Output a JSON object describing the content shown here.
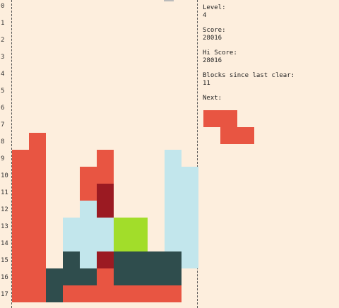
{
  "row_numbers": [
    "0",
    "1",
    "2",
    "3",
    "4",
    "5",
    "6",
    "7",
    "8",
    "9",
    "10",
    "11",
    "12",
    "13",
    "14",
    "15",
    "16",
    "17"
  ],
  "colors": {
    "red": "#e85542",
    "darkred": "#9b1a22",
    "lightblue": "#c2e6ec",
    "green": "#a2dd2a",
    "darkslate": "#2f4d4d",
    "background": "#fdeedd"
  },
  "info": {
    "level_label": "Level:",
    "level_value": "4",
    "score_label": "Score:",
    "score_value": "28016",
    "hiscore_label": "Hi Score:",
    "hiscore_value": "28016",
    "blocks_label": "Blocks since last clear:",
    "blocks_value": "11",
    "next_label": "Next:"
  },
  "board": {
    "columns": 11,
    "cells": [
      {
        "row": 8,
        "col": 1,
        "color": "red"
      },
      {
        "row": 9,
        "col": 0,
        "color": "red"
      },
      {
        "row": 9,
        "col": 1,
        "color": "red"
      },
      {
        "row": 9,
        "col": 5,
        "color": "red"
      },
      {
        "row": 9,
        "col": 9,
        "color": "lightblue"
      },
      {
        "row": 10,
        "col": 0,
        "color": "red"
      },
      {
        "row": 10,
        "col": 1,
        "color": "red"
      },
      {
        "row": 10,
        "col": 4,
        "color": "red"
      },
      {
        "row": 10,
        "col": 5,
        "color": "red"
      },
      {
        "row": 10,
        "col": 9,
        "color": "lightblue"
      },
      {
        "row": 10,
        "col": 10,
        "color": "lightblue"
      },
      {
        "row": 11,
        "col": 0,
        "color": "red"
      },
      {
        "row": 11,
        "col": 1,
        "color": "red"
      },
      {
        "row": 11,
        "col": 4,
        "color": "red"
      },
      {
        "row": 11,
        "col": 5,
        "color": "darkred"
      },
      {
        "row": 11,
        "col": 9,
        "color": "lightblue"
      },
      {
        "row": 11,
        "col": 10,
        "color": "lightblue"
      },
      {
        "row": 12,
        "col": 0,
        "color": "red"
      },
      {
        "row": 12,
        "col": 1,
        "color": "red"
      },
      {
        "row": 12,
        "col": 4,
        "color": "lightblue"
      },
      {
        "row": 12,
        "col": 5,
        "color": "darkred"
      },
      {
        "row": 12,
        "col": 9,
        "color": "lightblue"
      },
      {
        "row": 12,
        "col": 10,
        "color": "lightblue"
      },
      {
        "row": 13,
        "col": 0,
        "color": "red"
      },
      {
        "row": 13,
        "col": 1,
        "color": "red"
      },
      {
        "row": 13,
        "col": 3,
        "color": "lightblue"
      },
      {
        "row": 13,
        "col": 4,
        "color": "lightblue"
      },
      {
        "row": 13,
        "col": 5,
        "color": "lightblue"
      },
      {
        "row": 13,
        "col": 6,
        "color": "green"
      },
      {
        "row": 13,
        "col": 7,
        "color": "green"
      },
      {
        "row": 13,
        "col": 9,
        "color": "lightblue"
      },
      {
        "row": 13,
        "col": 10,
        "color": "lightblue"
      },
      {
        "row": 14,
        "col": 0,
        "color": "red"
      },
      {
        "row": 14,
        "col": 1,
        "color": "red"
      },
      {
        "row": 14,
        "col": 3,
        "color": "lightblue"
      },
      {
        "row": 14,
        "col": 4,
        "color": "lightblue"
      },
      {
        "row": 14,
        "col": 5,
        "color": "lightblue"
      },
      {
        "row": 14,
        "col": 6,
        "color": "green"
      },
      {
        "row": 14,
        "col": 7,
        "color": "green"
      },
      {
        "row": 14,
        "col": 9,
        "color": "lightblue"
      },
      {
        "row": 14,
        "col": 10,
        "color": "lightblue"
      },
      {
        "row": 15,
        "col": 0,
        "color": "red"
      },
      {
        "row": 15,
        "col": 1,
        "color": "red"
      },
      {
        "row": 15,
        "col": 3,
        "color": "darkslate"
      },
      {
        "row": 15,
        "col": 4,
        "color": "lightblue"
      },
      {
        "row": 15,
        "col": 5,
        "color": "darkred"
      },
      {
        "row": 15,
        "col": 6,
        "color": "darkslate"
      },
      {
        "row": 15,
        "col": 7,
        "color": "darkslate"
      },
      {
        "row": 15,
        "col": 8,
        "color": "darkslate"
      },
      {
        "row": 15,
        "col": 9,
        "color": "darkslate"
      },
      {
        "row": 15,
        "col": 10,
        "color": "lightblue"
      },
      {
        "row": 16,
        "col": 0,
        "color": "red"
      },
      {
        "row": 16,
        "col": 1,
        "color": "red"
      },
      {
        "row": 16,
        "col": 2,
        "color": "darkslate"
      },
      {
        "row": 16,
        "col": 3,
        "color": "darkslate"
      },
      {
        "row": 16,
        "col": 4,
        "color": "darkslate"
      },
      {
        "row": 16,
        "col": 5,
        "color": "red"
      },
      {
        "row": 16,
        "col": 6,
        "color": "darkslate"
      },
      {
        "row": 16,
        "col": 7,
        "color": "darkslate"
      },
      {
        "row": 16,
        "col": 8,
        "color": "darkslate"
      },
      {
        "row": 16,
        "col": 9,
        "color": "darkslate"
      },
      {
        "row": 17,
        "col": 0,
        "color": "red"
      },
      {
        "row": 17,
        "col": 1,
        "color": "red"
      },
      {
        "row": 17,
        "col": 2,
        "color": "darkslate"
      },
      {
        "row": 17,
        "col": 3,
        "color": "red"
      },
      {
        "row": 17,
        "col": 4,
        "color": "red"
      },
      {
        "row": 17,
        "col": 5,
        "color": "red"
      },
      {
        "row": 17,
        "col": 6,
        "color": "red"
      },
      {
        "row": 17,
        "col": 7,
        "color": "red"
      },
      {
        "row": 17,
        "col": 8,
        "color": "red"
      },
      {
        "row": 17,
        "col": 9,
        "color": "red"
      }
    ]
  },
  "next_piece": {
    "color": "red",
    "cells": [
      {
        "row": 0,
        "col": 0
      },
      {
        "row": 0,
        "col": 1
      },
      {
        "row": 1,
        "col": 1
      },
      {
        "row": 1,
        "col": 2
      }
    ]
  }
}
